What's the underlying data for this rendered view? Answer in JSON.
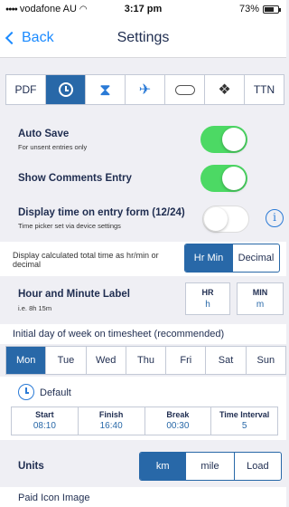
{
  "status": {
    "carrier": "vodafone AU",
    "time": "3:17 pm",
    "battery": "73%",
    "battery_level": 0.73
  },
  "nav": {
    "back_label": "Back",
    "title": "Settings"
  },
  "icon_tabs": [
    {
      "label": "PDF",
      "icon": ""
    },
    {
      "label": "",
      "icon": "clock-icon"
    },
    {
      "label": "",
      "icon": "hourglass-icon"
    },
    {
      "label": "",
      "icon": "airplane-icon"
    },
    {
      "label": "",
      "icon": "cloud-icon"
    },
    {
      "label": "",
      "icon": "dropbox-icon"
    },
    {
      "label": "TTN",
      "icon": ""
    }
  ],
  "auto_save": {
    "label": "Auto Save",
    "sub": "For unsent entries only",
    "on": true
  },
  "show_comments": {
    "label": "Show Comments Entry",
    "on": true
  },
  "display_time": {
    "label": "Display time on entry form (12/24)",
    "sub": "Time picker set via device settings",
    "on": false,
    "info": "i"
  },
  "calc_total": {
    "label": "Display calculated total time as hr/min or decimal",
    "options": [
      "Hr Min",
      "Decimal"
    ],
    "selected": "Hr Min"
  },
  "hour_minute": {
    "label": "Hour and Minute Label",
    "sub": "i.e. 8h 15m",
    "hr_head": "HR",
    "hr_val": "h",
    "min_head": "MIN",
    "min_val": "m"
  },
  "initial_day": {
    "label": "Initial day of week on timesheet (recommended)",
    "days": [
      "Mon",
      "Tue",
      "Wed",
      "Thu",
      "Fri",
      "Sat",
      "Sun"
    ],
    "selected": "Mon"
  },
  "defaults": {
    "label": "Default",
    "columns": [
      {
        "head": "Start",
        "value": "08:10"
      },
      {
        "head": "Finish",
        "value": "16:40"
      },
      {
        "head": "Break",
        "value": "00:30"
      },
      {
        "head": "Time Interval",
        "value": "5"
      }
    ]
  },
  "units": {
    "label": "Units",
    "options": [
      "km",
      "mile",
      "Load"
    ],
    "selected": "km"
  },
  "paid_icon": {
    "label": "Paid Icon Image"
  },
  "colors": {
    "accent": "#2868a8",
    "toggle_on": "#4cd964",
    "ios_blue": "#1a8aff"
  }
}
